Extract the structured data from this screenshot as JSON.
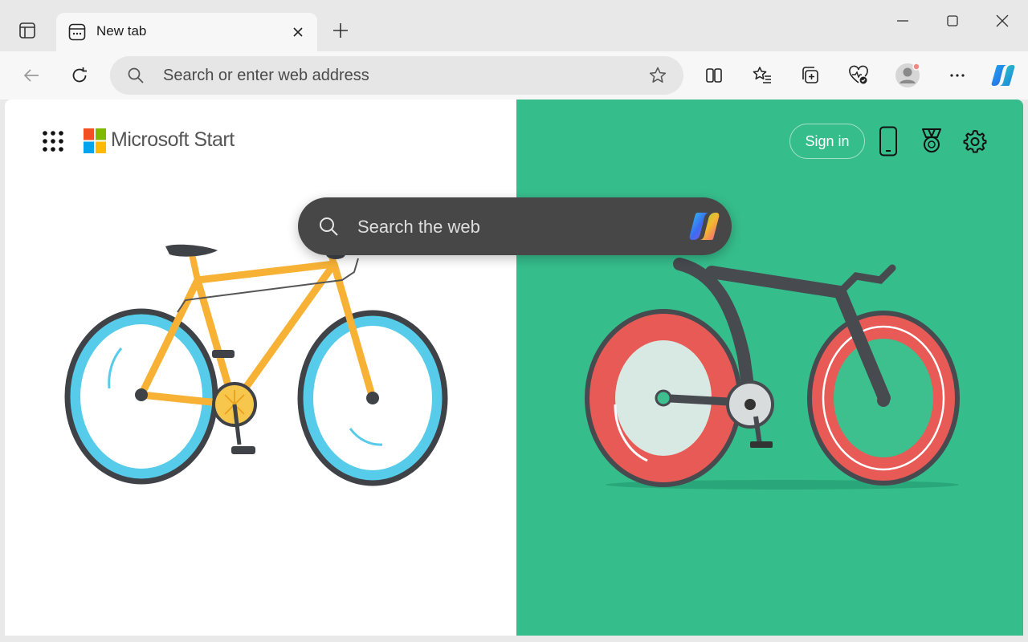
{
  "browser": {
    "tab": {
      "title": "New tab"
    },
    "address_bar": {
      "placeholder": "Search or enter web address"
    }
  },
  "page": {
    "brand": "Microsoft Start",
    "signin_label": "Sign in",
    "search_placeholder": "Search the web"
  },
  "colors": {
    "left_background": "#ffffff",
    "right_background": "#36bd8c",
    "search_box": "#474747"
  },
  "icons": {
    "titlebar": [
      "tab-actions-icon",
      "new-tab-icon",
      "minimize-icon",
      "maximize-icon",
      "close-window-icon"
    ],
    "toolbar": [
      "back-icon",
      "refresh-icon",
      "search-icon",
      "star-icon",
      "split-screen-icon",
      "favorites-icon",
      "collections-icon",
      "browser-essentials-icon",
      "profile-icon",
      "more-icon",
      "copilot-icon"
    ],
    "page": [
      "apps-waffle-icon",
      "microsoft-logo",
      "phone-icon",
      "rewards-icon",
      "settings-icon",
      "copilot-icon"
    ]
  }
}
